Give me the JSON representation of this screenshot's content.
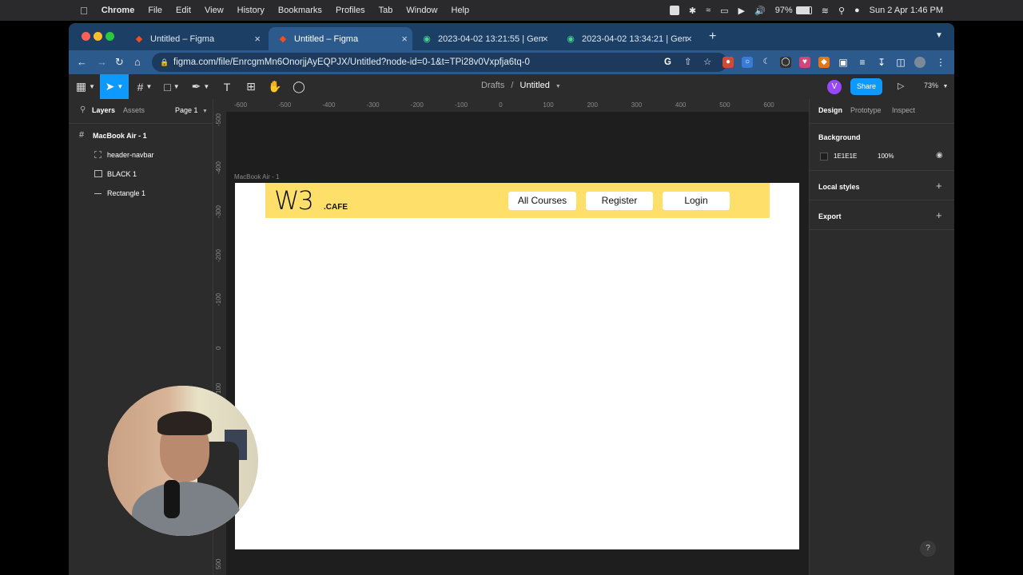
{
  "menubar": {
    "app": "Chrome",
    "items": [
      "File",
      "Edit",
      "View",
      "History",
      "Bookmarks",
      "Profiles",
      "Tab",
      "Window",
      "Help"
    ],
    "battery": "97%",
    "datetime": "Sun 2 Apr  1:46 PM"
  },
  "browser": {
    "tabs": [
      {
        "title": "Untitled – Figma",
        "active": false
      },
      {
        "title": "Untitled – Figma",
        "active": true
      },
      {
        "title": "2023-04-02 13:21:55 | Gemoo",
        "active": false
      },
      {
        "title": "2023-04-02 13:34:21 | Gemoo",
        "active": false
      }
    ],
    "url": "figma.com/file/EnrcgmMn6OnorjjAyEQPJX/Untitled?node-id=0-1&t=TPi28v0Vxpfja6tq-0"
  },
  "figma": {
    "breadcrumb_root": "Drafts",
    "file_name": "Untitled",
    "avatar_letter": "V",
    "share_label": "Share",
    "zoom": "73%",
    "left_tabs": {
      "layers": "Layers",
      "assets": "Assets",
      "page": "Page 1"
    },
    "layers": [
      {
        "name": "MacBook Air - 1",
        "level": 0,
        "icon": "frame-icon"
      },
      {
        "name": "header-navbar",
        "level": 1,
        "icon": "group-icon"
      },
      {
        "name": "BLACK 1",
        "level": 1,
        "icon": "image-icon"
      },
      {
        "name": "Rectangle 1",
        "level": 1,
        "icon": "line-icon"
      }
    ],
    "right_tabs": {
      "design": "Design",
      "prototype": "Prototype",
      "inspect": "Inspect"
    },
    "background_label": "Background",
    "background_hex": "1E1E1E",
    "background_opacity": "100%",
    "local_styles": "Local styles",
    "export": "Export",
    "frame_label": "MacBook Air - 1",
    "ruler_h": [
      "-600",
      "-500",
      "-400",
      "-300",
      "-200",
      "-100",
      "0",
      "100",
      "200",
      "300",
      "400",
      "500",
      "600"
    ],
    "ruler_v": [
      "-500",
      "-400",
      "-300",
      "-200",
      "-100",
      "0",
      "100",
      "500"
    ],
    "help": "?"
  },
  "design": {
    "logo_main": "W3",
    "logo_sub": ".CAFE",
    "nav_buttons": [
      "All Courses",
      "Register",
      "Login"
    ],
    "navbar_color": "#fddf6a"
  },
  "colors": {
    "accent": "#0d99ff",
    "tabstrip": "#1c3f66",
    "active_tab": "#2d5a8c",
    "panel": "#2c2c2c",
    "canvas": "#1e1e1e"
  }
}
